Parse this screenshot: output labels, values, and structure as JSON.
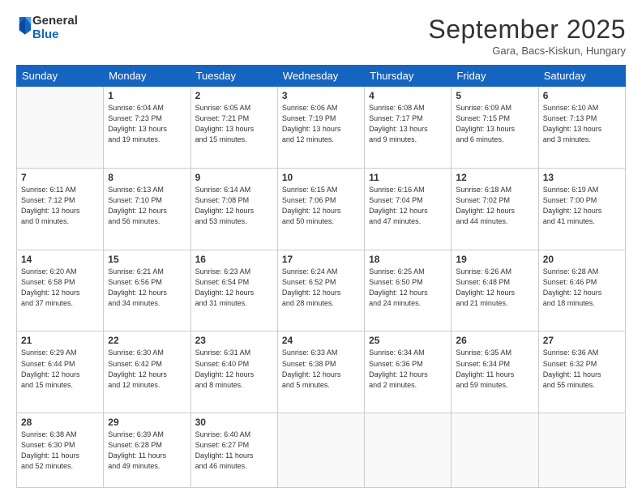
{
  "header": {
    "logo": {
      "general": "General",
      "blue": "Blue"
    },
    "title": "September 2025",
    "location": "Gara, Bacs-Kiskun, Hungary"
  },
  "days_of_week": [
    "Sunday",
    "Monday",
    "Tuesday",
    "Wednesday",
    "Thursday",
    "Friday",
    "Saturday"
  ],
  "weeks": [
    [
      {
        "date": "",
        "info": ""
      },
      {
        "date": "1",
        "info": "Sunrise: 6:04 AM\nSunset: 7:23 PM\nDaylight: 13 hours\nand 19 minutes."
      },
      {
        "date": "2",
        "info": "Sunrise: 6:05 AM\nSunset: 7:21 PM\nDaylight: 13 hours\nand 15 minutes."
      },
      {
        "date": "3",
        "info": "Sunrise: 6:06 AM\nSunset: 7:19 PM\nDaylight: 13 hours\nand 12 minutes."
      },
      {
        "date": "4",
        "info": "Sunrise: 6:08 AM\nSunset: 7:17 PM\nDaylight: 13 hours\nand 9 minutes."
      },
      {
        "date": "5",
        "info": "Sunrise: 6:09 AM\nSunset: 7:15 PM\nDaylight: 13 hours\nand 6 minutes."
      },
      {
        "date": "6",
        "info": "Sunrise: 6:10 AM\nSunset: 7:13 PM\nDaylight: 13 hours\nand 3 minutes."
      }
    ],
    [
      {
        "date": "7",
        "info": "Sunrise: 6:11 AM\nSunset: 7:12 PM\nDaylight: 13 hours\nand 0 minutes."
      },
      {
        "date": "8",
        "info": "Sunrise: 6:13 AM\nSunset: 7:10 PM\nDaylight: 12 hours\nand 56 minutes."
      },
      {
        "date": "9",
        "info": "Sunrise: 6:14 AM\nSunset: 7:08 PM\nDaylight: 12 hours\nand 53 minutes."
      },
      {
        "date": "10",
        "info": "Sunrise: 6:15 AM\nSunset: 7:06 PM\nDaylight: 12 hours\nand 50 minutes."
      },
      {
        "date": "11",
        "info": "Sunrise: 6:16 AM\nSunset: 7:04 PM\nDaylight: 12 hours\nand 47 minutes."
      },
      {
        "date": "12",
        "info": "Sunrise: 6:18 AM\nSunset: 7:02 PM\nDaylight: 12 hours\nand 44 minutes."
      },
      {
        "date": "13",
        "info": "Sunrise: 6:19 AM\nSunset: 7:00 PM\nDaylight: 12 hours\nand 41 minutes."
      }
    ],
    [
      {
        "date": "14",
        "info": "Sunrise: 6:20 AM\nSunset: 6:58 PM\nDaylight: 12 hours\nand 37 minutes."
      },
      {
        "date": "15",
        "info": "Sunrise: 6:21 AM\nSunset: 6:56 PM\nDaylight: 12 hours\nand 34 minutes."
      },
      {
        "date": "16",
        "info": "Sunrise: 6:23 AM\nSunset: 6:54 PM\nDaylight: 12 hours\nand 31 minutes."
      },
      {
        "date": "17",
        "info": "Sunrise: 6:24 AM\nSunset: 6:52 PM\nDaylight: 12 hours\nand 28 minutes."
      },
      {
        "date": "18",
        "info": "Sunrise: 6:25 AM\nSunset: 6:50 PM\nDaylight: 12 hours\nand 24 minutes."
      },
      {
        "date": "19",
        "info": "Sunrise: 6:26 AM\nSunset: 6:48 PM\nDaylight: 12 hours\nand 21 minutes."
      },
      {
        "date": "20",
        "info": "Sunrise: 6:28 AM\nSunset: 6:46 PM\nDaylight: 12 hours\nand 18 minutes."
      }
    ],
    [
      {
        "date": "21",
        "info": "Sunrise: 6:29 AM\nSunset: 6:44 PM\nDaylight: 12 hours\nand 15 minutes."
      },
      {
        "date": "22",
        "info": "Sunrise: 6:30 AM\nSunset: 6:42 PM\nDaylight: 12 hours\nand 12 minutes."
      },
      {
        "date": "23",
        "info": "Sunrise: 6:31 AM\nSunset: 6:40 PM\nDaylight: 12 hours\nand 8 minutes."
      },
      {
        "date": "24",
        "info": "Sunrise: 6:33 AM\nSunset: 6:38 PM\nDaylight: 12 hours\nand 5 minutes."
      },
      {
        "date": "25",
        "info": "Sunrise: 6:34 AM\nSunset: 6:36 PM\nDaylight: 12 hours\nand 2 minutes."
      },
      {
        "date": "26",
        "info": "Sunrise: 6:35 AM\nSunset: 6:34 PM\nDaylight: 11 hours\nand 59 minutes."
      },
      {
        "date": "27",
        "info": "Sunrise: 6:36 AM\nSunset: 6:32 PM\nDaylight: 11 hours\nand 55 minutes."
      }
    ],
    [
      {
        "date": "28",
        "info": "Sunrise: 6:38 AM\nSunset: 6:30 PM\nDaylight: 11 hours\nand 52 minutes."
      },
      {
        "date": "29",
        "info": "Sunrise: 6:39 AM\nSunset: 6:28 PM\nDaylight: 11 hours\nand 49 minutes."
      },
      {
        "date": "30",
        "info": "Sunrise: 6:40 AM\nSunset: 6:27 PM\nDaylight: 11 hours\nand 46 minutes."
      },
      {
        "date": "",
        "info": ""
      },
      {
        "date": "",
        "info": ""
      },
      {
        "date": "",
        "info": ""
      },
      {
        "date": "",
        "info": ""
      }
    ]
  ]
}
